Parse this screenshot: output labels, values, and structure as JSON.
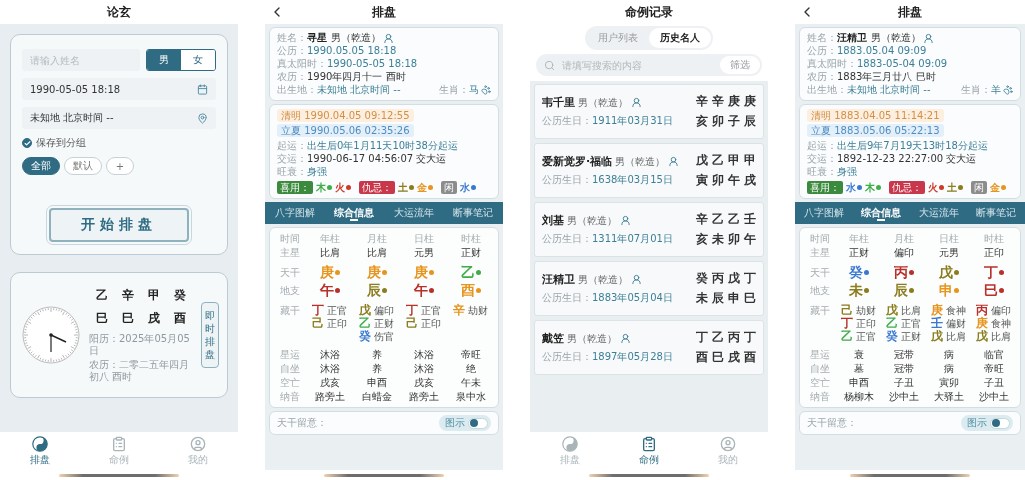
{
  "screens": [
    {
      "kind": "home",
      "title": "论玄",
      "form": {
        "name_placeholder": "请输入姓名",
        "genders": [
          {
            "label": "男",
            "selected": true
          },
          {
            "label": "女",
            "selected": false
          }
        ],
        "date": "1990-05-05 18:18",
        "place": "未知地 北京时间 --",
        "save": {
          "label": "保存到分组",
          "checked": true
        },
        "groups": [
          {
            "label": "全部",
            "selected": true
          },
          {
            "label": "默认",
            "selected": false
          },
          {
            "label": "+",
            "selected": false
          }
        ],
        "start": "开始排盘"
      },
      "now": {
        "pillars": [
          [
            "乙",
            "辛",
            "甲",
            "癸"
          ],
          [
            "巳",
            "巳",
            "戌",
            "酉"
          ]
        ],
        "solar": "阳历：2025年05月05日",
        "lunar": "农历：二零二五年四月初八 酉时",
        "button": "即时排盘"
      },
      "tabbar": [
        {
          "label": "排盘",
          "selected": true
        },
        {
          "label": "命例",
          "selected": false
        },
        {
          "label": "我的",
          "selected": false
        }
      ]
    },
    {
      "kind": "chart",
      "title": "排盘",
      "profile": {
        "name_label": "姓名：",
        "name": "寻星",
        "gender": "男（乾造）",
        "lines": [
          [
            {
              "label": "公历：",
              "value": "1990.05.05 18:18",
              "kind": "accent"
            },
            {
              "label": "真太阳时：",
              "value": "1990-05-05 18:18",
              "kind": "accent"
            }
          ],
          [
            {
              "label": "农历：",
              "value": "1990年四月十一 酉时",
              "kind": "plain"
            }
          ],
          [
            {
              "label": "出生地：",
              "value": "未知地 北京时间 --",
              "kind": "accent"
            },
            {
              "label": "生肖：",
              "value": "马",
              "kind": "accent"
            }
          ]
        ]
      },
      "luck": {
        "terms": [
          {
            "text": "清明 1990.04.05 09:12:55",
            "kind": "past"
          },
          {
            "text": "立夏 1990.05.06 02:35:26",
            "kind": "next"
          }
        ],
        "lines": [
          {
            "label": "起运：",
            "value": "出生后0年1月11天10时38分起运",
            "kind": "accent"
          },
          {
            "label": "交运：",
            "value": "1990-06-17 04:56:07 交大运",
            "kind": "plain"
          },
          {
            "label": "旺衰：",
            "value": "身强",
            "kind": "accent"
          }
        ],
        "elements": [
          {
            "label": "喜用：",
            "kind": "favorable",
            "items": [
              {
                "text": "木",
                "color": "#3fae49"
              },
              {
                "text": "火",
                "color": "#cc3a2c"
              }
            ]
          },
          {
            "label": "仇忌：",
            "kind": "adverse",
            "items": [
              {
                "text": "土",
                "color": "#8b7d1e"
              },
              {
                "text": "金",
                "color": "#e6951e"
              }
            ]
          },
          {
            "label": "闲",
            "kind": "neutral",
            "items": [
              {
                "text": "水",
                "color": "#3a78d0"
              }
            ]
          }
        ]
      },
      "tabs": [
        {
          "label": "八字图解",
          "selected": false
        },
        {
          "label": "综合信息",
          "selected": true
        },
        {
          "label": "大运流年",
          "selected": false
        },
        {
          "label": "断事笔记",
          "selected": false
        }
      ],
      "table": {
        "header": [
          "时间",
          "年柱",
          "月柱",
          "日柱",
          "时柱"
        ],
        "rows": [
          {
            "kind": "text",
            "label": "主星",
            "cells": [
              "比肩",
              "比肩",
              "元男",
              "正财"
            ]
          },
          {
            "kind": "stem",
            "label": "天干",
            "cells": [
              {
                "text": "庚",
                "color": "#e6951e"
              },
              {
                "text": "庚",
                "color": "#e6951e"
              },
              {
                "text": "庚",
                "color": "#e6951e"
              },
              {
                "text": "乙",
                "color": "#3fae49"
              }
            ]
          },
          {
            "kind": "stem",
            "label": "地支",
            "cells": [
              {
                "text": "午",
                "color": "#b8302a"
              },
              {
                "text": "辰",
                "color": "#8b7d1e"
              },
              {
                "text": "午",
                "color": "#b8302a"
              },
              {
                "text": "酉",
                "color": "#e6951e"
              }
            ]
          },
          {
            "kind": "hidden",
            "label": "藏干",
            "cells": [
              [
                {
                  "stem": "丁",
                  "color": "#b8302a",
                  "god": "正官"
                },
                {
                  "stem": "己",
                  "color": "#8b7d1e",
                  "god": "正印"
                }
              ],
              [
                {
                  "stem": "戊",
                  "color": "#8b7d1e",
                  "god": "偏印"
                },
                {
                  "stem": "乙",
                  "color": "#3fae49",
                  "god": "正财"
                },
                {
                  "stem": "癸",
                  "color": "#3a78d0",
                  "god": "伤官"
                }
              ],
              [
                {
                  "stem": "丁",
                  "color": "#b8302a",
                  "god": "正官"
                },
                {
                  "stem": "己",
                  "color": "#8b7d1e",
                  "god": "正印"
                }
              ],
              [
                {
                  "stem": "辛",
                  "color": "#e6951e",
                  "god": "劫财"
                }
              ]
            ]
          },
          {
            "kind": "text",
            "label": "星运",
            "cells": [
              "沐浴",
              "养",
              "沐浴",
              "帝旺"
            ]
          },
          {
            "kind": "text",
            "label": "自坐",
            "cells": [
              "沐浴",
              "养",
              "沐浴",
              "绝"
            ]
          },
          {
            "kind": "text",
            "label": "空亡",
            "cells": [
              "戌亥",
              "申酉",
              "戌亥",
              "午未"
            ]
          },
          {
            "kind": "text",
            "label": "纳音",
            "cells": [
              "路旁土",
              "白蜡金",
              "路旁土",
              "泉中水"
            ]
          }
        ]
      },
      "footer": {
        "label": "天干留意：",
        "toggle": {
          "label": "图示",
          "on": false
        }
      }
    },
    {
      "kind": "records",
      "title": "命例记录",
      "segments": [
        {
          "label": "用户列表",
          "selected": false
        },
        {
          "label": "历史名人",
          "selected": true
        }
      ],
      "search": {
        "placeholder": "请填写搜索的内容",
        "filter": "筛选"
      },
      "records": [
        {
          "name": "韦千里",
          "gender": "男（乾造）",
          "birth_label": "公历生日：",
          "birth": "1911年03月31日",
          "pillars": [
            [
              "辛",
              "辛",
              "庚",
              "庚"
            ],
            [
              "亥",
              "卯",
              "子",
              "辰"
            ]
          ]
        },
        {
          "name": "爱新觉罗·福临",
          "gender": "男（乾造）",
          "birth_label": "公历生日：",
          "birth": "1638年03月15日",
          "pillars": [
            [
              "戊",
              "乙",
              "甲",
              "甲"
            ],
            [
              "寅",
              "卯",
              "午",
              "戌"
            ]
          ]
        },
        {
          "name": "刘基",
          "gender": "男（乾造）",
          "birth_label": "公历生日：",
          "birth": "1311年07月01日",
          "pillars": [
            [
              "辛",
              "乙",
              "乙",
              "壬"
            ],
            [
              "亥",
              "未",
              "卯",
              "午"
            ]
          ]
        },
        {
          "name": "汪精卫",
          "gender": "男（乾造）",
          "birth_label": "公历生日：",
          "birth": "1883年05月04日",
          "pillars": [
            [
              "癸",
              "丙",
              "戊",
              "丁"
            ],
            [
              "未",
              "辰",
              "申",
              "巳"
            ]
          ]
        },
        {
          "name": "戴笠",
          "gender": "男（乾造）",
          "birth_label": "公历生日：",
          "birth": "1897年05月28日",
          "pillars": [
            [
              "丁",
              "乙",
              "丙",
              "丁"
            ],
            [
              "酉",
              "巳",
              "戌",
              "酉"
            ]
          ]
        }
      ],
      "tabbar": [
        {
          "label": "排盘",
          "selected": false
        },
        {
          "label": "命例",
          "selected": true
        },
        {
          "label": "我的",
          "selected": false
        }
      ]
    },
    {
      "kind": "chart",
      "title": "排盘",
      "profile": {
        "name_label": "姓名：",
        "name": "汪精卫",
        "gender": "男（乾造）",
        "lines": [
          [
            {
              "label": "公历：",
              "value": "1883.05.04 09:09",
              "kind": "accent"
            },
            {
              "label": "真太阳时：",
              "value": "1883-05-04 09:09",
              "kind": "accent"
            }
          ],
          [
            {
              "label": "农历：",
              "value": "1883年三月廿八 巳时",
              "kind": "plain"
            }
          ],
          [
            {
              "label": "出生地：",
              "value": "未知地 北京时间 --",
              "kind": "accent"
            },
            {
              "label": "生肖：",
              "value": "羊",
              "kind": "accent"
            }
          ]
        ]
      },
      "luck": {
        "terms": [
          {
            "text": "清明 1883.04.05 11:14:21",
            "kind": "past"
          },
          {
            "text": "立夏 1883.05.06 05:22:13",
            "kind": "next"
          }
        ],
        "lines": [
          {
            "label": "起运：",
            "value": "出生后9年7月19天13时18分起运",
            "kind": "accent"
          },
          {
            "label": "交运：",
            "value": "1892-12-23 22:27:00 交大运",
            "kind": "plain"
          },
          {
            "label": "旺衰：",
            "value": "身强",
            "kind": "accent"
          }
        ],
        "elements": [
          {
            "label": "喜用：",
            "kind": "favorable",
            "items": [
              {
                "text": "水",
                "color": "#3a78d0"
              },
              {
                "text": "木",
                "color": "#3fae49"
              }
            ]
          },
          {
            "label": "仇忌：",
            "kind": "adverse",
            "items": [
              {
                "text": "火",
                "color": "#cc3a2c"
              },
              {
                "text": "土",
                "color": "#8b7d1e"
              }
            ]
          },
          {
            "label": "闲",
            "kind": "neutral",
            "items": [
              {
                "text": "金",
                "color": "#e6951e"
              }
            ]
          }
        ]
      },
      "tabs": [
        {
          "label": "八字图解",
          "selected": false
        },
        {
          "label": "综合信息",
          "selected": true
        },
        {
          "label": "大运流年",
          "selected": false
        },
        {
          "label": "断事笔记",
          "selected": false
        }
      ],
      "table": {
        "header": [
          "时间",
          "年柱",
          "月柱",
          "日柱",
          "时柱"
        ],
        "rows": [
          {
            "kind": "text",
            "label": "主星",
            "cells": [
              "正财",
              "偏印",
              "元男",
              "正印"
            ]
          },
          {
            "kind": "stem",
            "label": "天干",
            "cells": [
              {
                "text": "癸",
                "color": "#3a78d0"
              },
              {
                "text": "丙",
                "color": "#b8302a"
              },
              {
                "text": "戊",
                "color": "#8b7d1e"
              },
              {
                "text": "丁",
                "color": "#b8302a"
              }
            ]
          },
          {
            "kind": "stem",
            "label": "地支",
            "cells": [
              {
                "text": "未",
                "color": "#8b7d1e"
              },
              {
                "text": "辰",
                "color": "#8b7d1e"
              },
              {
                "text": "申",
                "color": "#e6951e"
              },
              {
                "text": "巳",
                "color": "#b8302a"
              }
            ]
          },
          {
            "kind": "hidden",
            "label": "藏干",
            "cells": [
              [
                {
                  "stem": "己",
                  "color": "#8b7d1e",
                  "god": "劫财"
                },
                {
                  "stem": "丁",
                  "color": "#b8302a",
                  "god": "正印"
                },
                {
                  "stem": "乙",
                  "color": "#3fae49",
                  "god": "正官"
                }
              ],
              [
                {
                  "stem": "戊",
                  "color": "#8b7d1e",
                  "god": "比肩"
                },
                {
                  "stem": "乙",
                  "color": "#3fae49",
                  "god": "正官"
                },
                {
                  "stem": "癸",
                  "color": "#3a78d0",
                  "god": "正财"
                }
              ],
              [
                {
                  "stem": "庚",
                  "color": "#e6951e",
                  "god": "食神"
                },
                {
                  "stem": "壬",
                  "color": "#3a78d0",
                  "god": "偏财"
                },
                {
                  "stem": "戊",
                  "color": "#8b7d1e",
                  "god": "比肩"
                }
              ],
              [
                {
                  "stem": "丙",
                  "color": "#b8302a",
                  "god": "偏印"
                },
                {
                  "stem": "庚",
                  "color": "#e6951e",
                  "god": "食神"
                },
                {
                  "stem": "戊",
                  "color": "#8b7d1e",
                  "god": "比肩"
                }
              ]
            ]
          },
          {
            "kind": "text",
            "label": "星运",
            "cells": [
              "衰",
              "冠带",
              "病",
              "临官"
            ]
          },
          {
            "kind": "text",
            "label": "自坐",
            "cells": [
              "墓",
              "冠带",
              "病",
              "帝旺"
            ]
          },
          {
            "kind": "text",
            "label": "空亡",
            "cells": [
              "申酉",
              "子丑",
              "寅卯",
              "子丑"
            ]
          },
          {
            "kind": "text",
            "label": "纳音",
            "cells": [
              "杨柳木",
              "沙中土",
              "大驿土",
              "沙中土"
            ]
          }
        ]
      },
      "footer": {
        "label": "天干留意：",
        "toggle": {
          "label": "图示",
          "on": false
        }
      }
    }
  ]
}
